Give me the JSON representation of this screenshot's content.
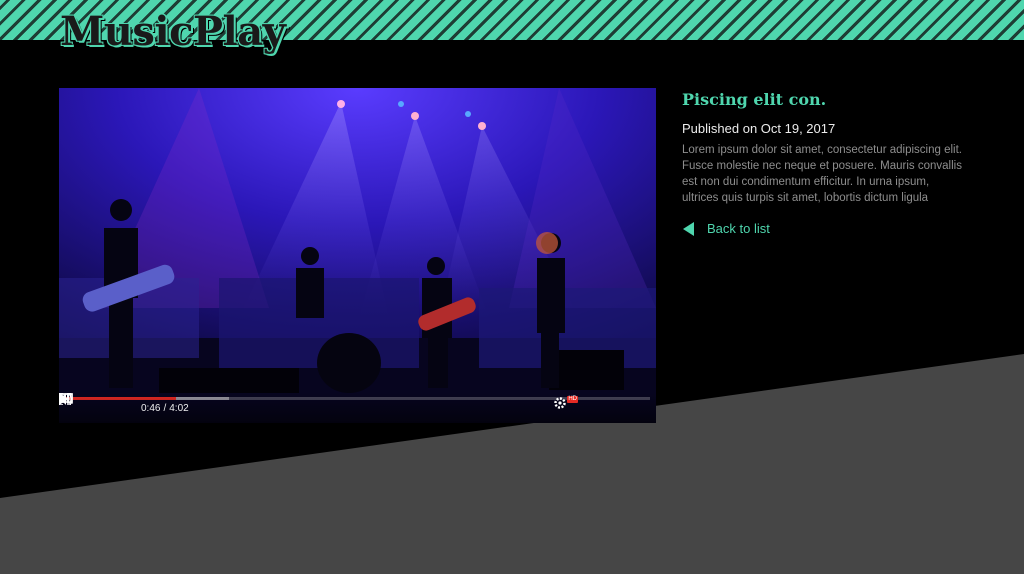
{
  "app": {
    "name": "MusicPlay"
  },
  "video": {
    "current_time": "0:46",
    "separator": "/",
    "duration": "4:02",
    "progress_played_fraction": 0.19,
    "progress_buffered_fraction": 0.28,
    "controls": [
      "play-icon",
      "next-icon",
      "volume-icon",
      "settings-icon",
      "theater-mode-icon",
      "cast-icon",
      "fullscreen-icon"
    ],
    "hd_badge": "HD"
  },
  "details": {
    "title": "Piscing elit con.",
    "published": "Published on Oct 19, 2017",
    "description": "Lorem ipsum dolor sit amet, consectetur adipiscing elit. Fusce molestie nec neque et posuere. Mauris convallis est non dui condimentum efficitur. In urna ipsum, ultrices quis turpis sit amet, lobortis dictum ligula",
    "back_label": "Back to list"
  },
  "colors": {
    "accent": "#4fd6ae",
    "band": "#464646",
    "background": "#000000",
    "progress": "#e52a24"
  }
}
